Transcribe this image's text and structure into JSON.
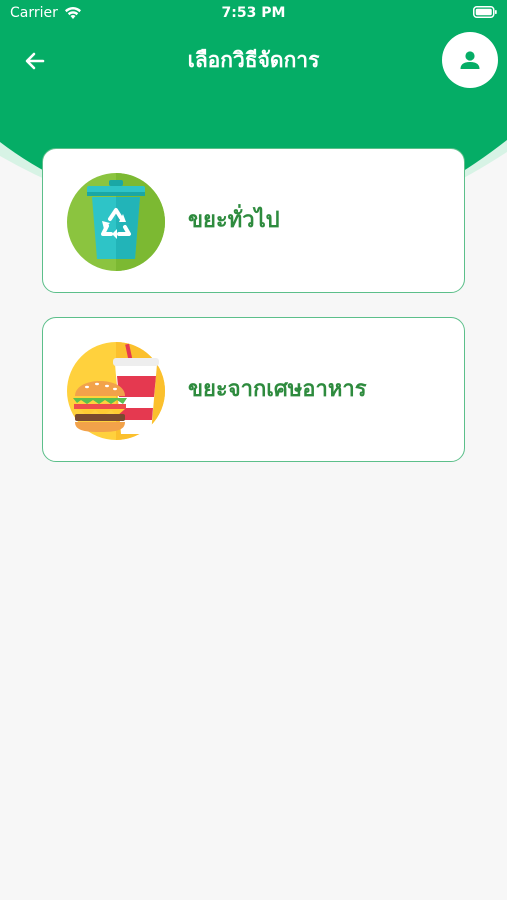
{
  "status_bar": {
    "carrier": "Carrier",
    "time": "7:53 PM"
  },
  "nav": {
    "title": "เลือกวิธีจัดการ",
    "back_icon": "arrow-left-icon",
    "profile_icon": "person-icon"
  },
  "options": [
    {
      "label": "ขยะทั่วไป",
      "icon": "recycle-bin-icon"
    },
    {
      "label": "ขยะจากเศษอาหาร",
      "icon": "food-burger-drink-icon"
    }
  ],
  "colors": {
    "header_green": "#05ad66",
    "accent_green": "#2e8b3e",
    "card_border": "#5cbf8a",
    "background": "#f7f7f7"
  }
}
